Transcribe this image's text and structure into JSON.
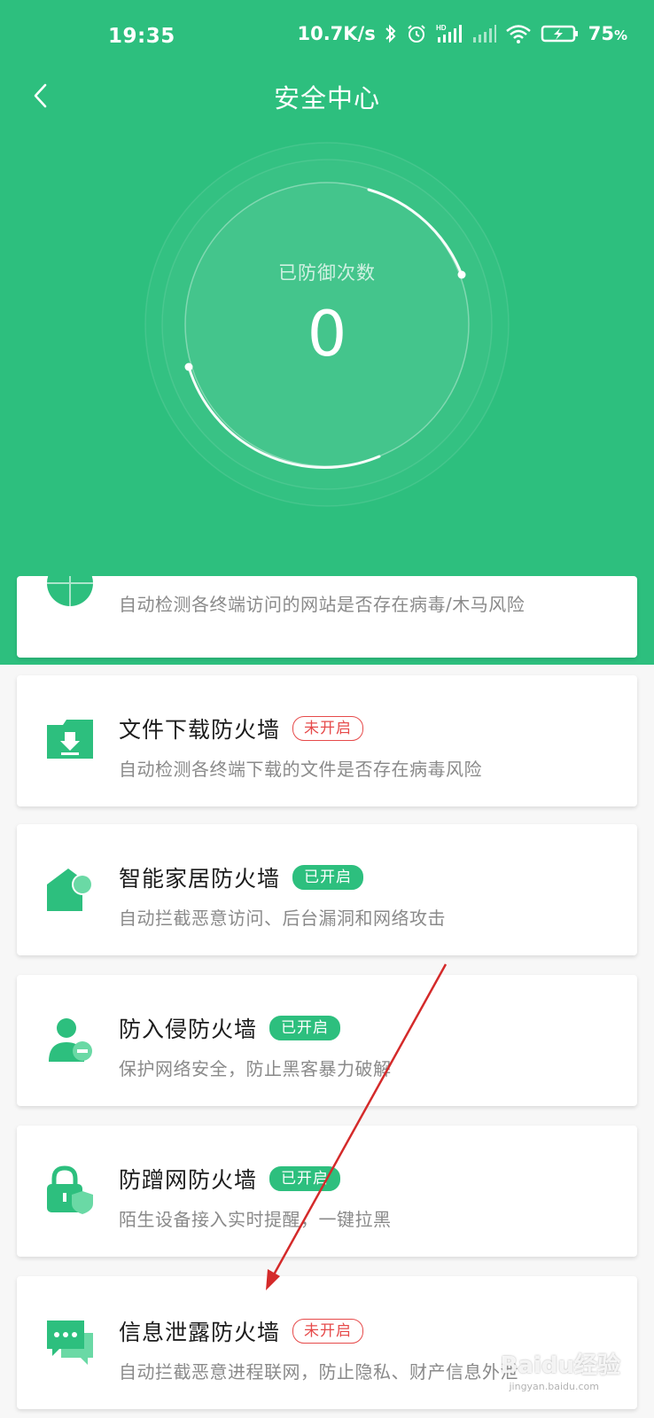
{
  "status_bar": {
    "time": "19:35",
    "speed": "10.7K/s",
    "battery": "75",
    "battery_unit": "%"
  },
  "header": {
    "title": "安全中心"
  },
  "defense": {
    "label": "已防御次数",
    "count": "0"
  },
  "cards": [
    {
      "desc": "自动检测各终端访问的网站是否存在病毒/木马风险"
    },
    {
      "title": "文件下载防火墙",
      "status": "未开启",
      "desc": "自动检测各终端下载的文件是否存在病毒风险"
    },
    {
      "title": "智能家居防火墙",
      "status": "已开启",
      "desc": "自动拦截恶意访问、后台漏洞和网络攻击"
    },
    {
      "title": "防入侵防火墙",
      "status": "已开启",
      "desc": "保护网络安全，防止黑客暴力破解"
    },
    {
      "title": "防蹭网防火墙",
      "status": "已开启",
      "desc": "陌生设备接入实时提醒，一键拉黑"
    },
    {
      "title": "信息泄露防火墙",
      "status": "未开启",
      "desc": "自动拦截恶意进程联网，防止隐私、财产信息外泄"
    }
  ],
  "watermark": {
    "text": "Baidu经验",
    "sub": "jingyan.baidu.com"
  },
  "colors": {
    "primary": "#2dbf7e",
    "off": "#e64a4a",
    "arrow": "#d42a2a"
  },
  "icons": [
    "back-arrow",
    "globe",
    "file-download",
    "smart-home",
    "user-shield",
    "lock-shield",
    "chat-bubbles"
  ]
}
